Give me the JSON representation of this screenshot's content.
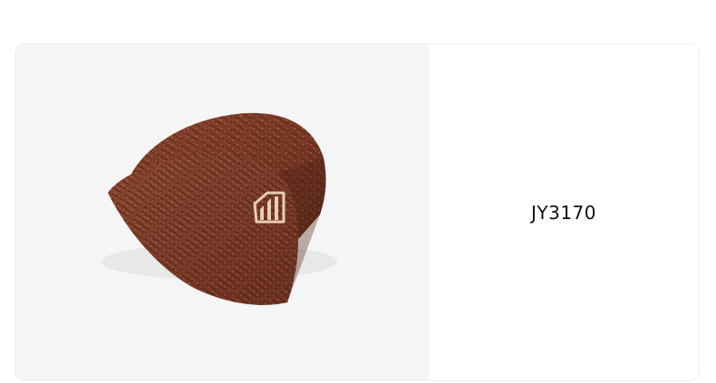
{
  "product": {
    "code": "JY3170",
    "image": {
      "subject": "beanie-hat",
      "main_color": "#7a3a26",
      "logo_icon": "adidas-three-bars-logo-icon",
      "background_color": "#f5f5f5"
    }
  }
}
